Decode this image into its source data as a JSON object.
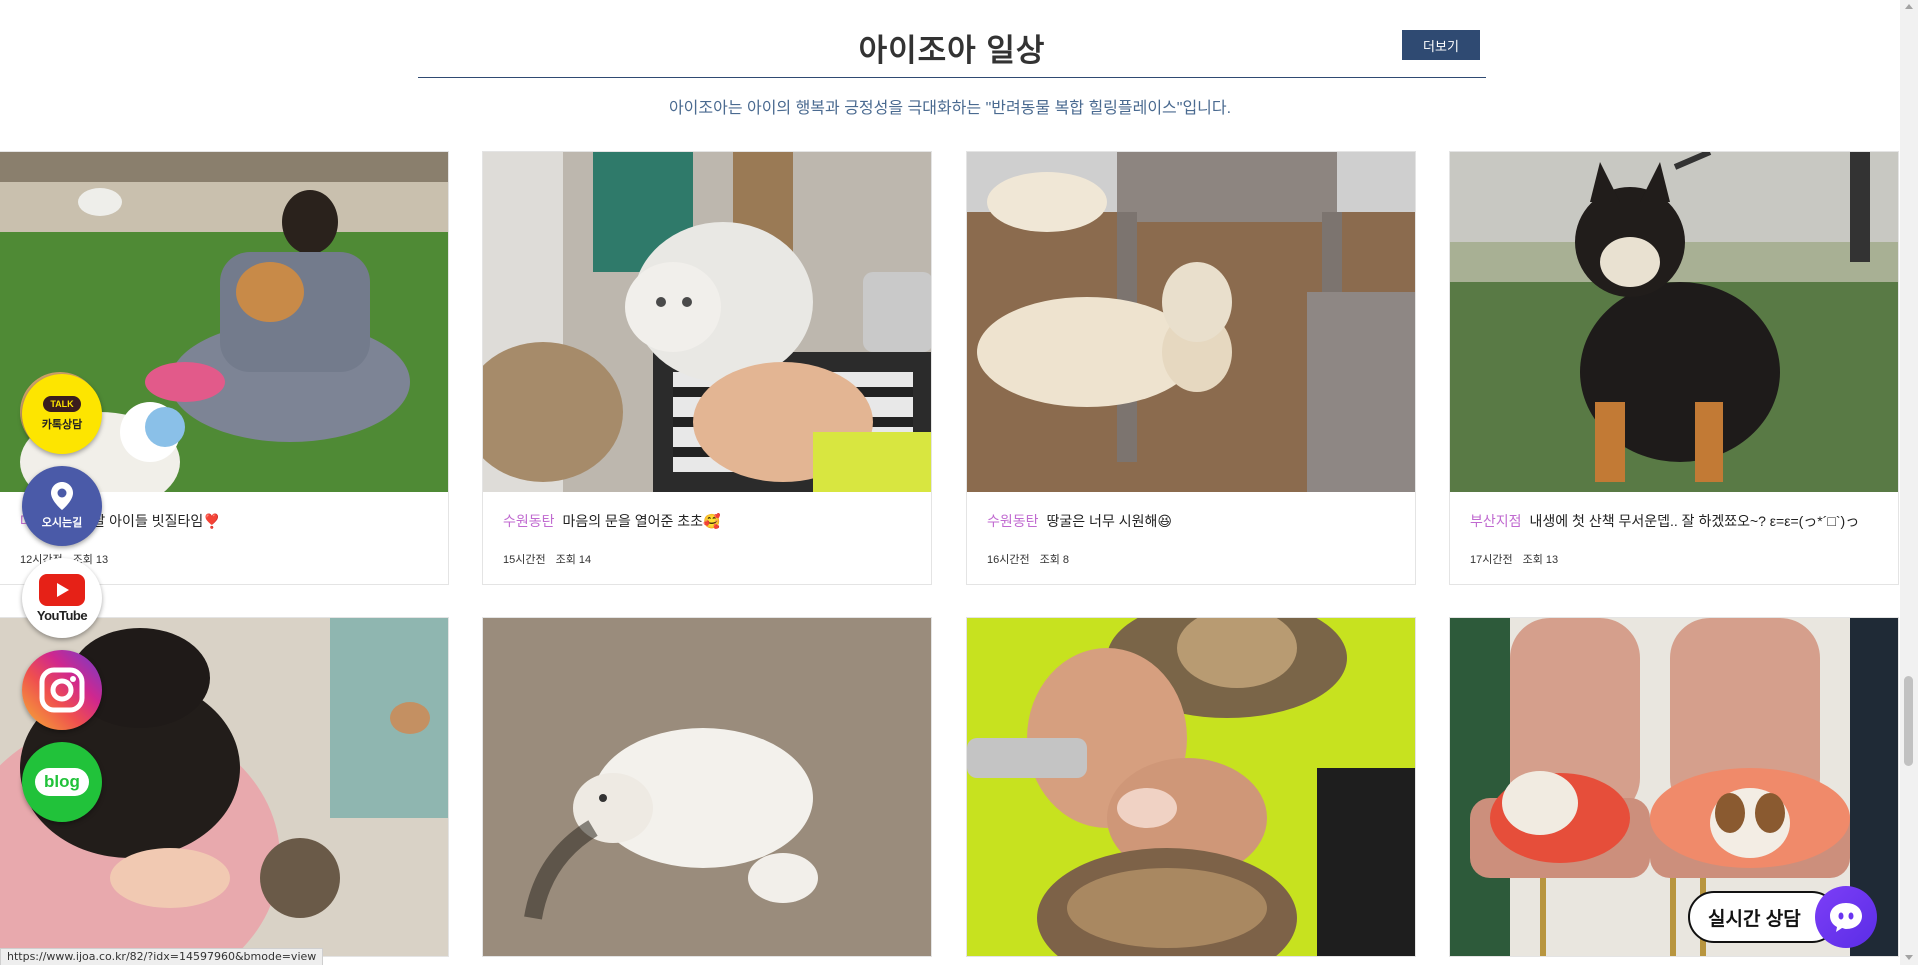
{
  "section": {
    "title": "아이조아 일상",
    "more_label": "더보기",
    "subtitle": "아이조아는 아이의 행복과 긍정성을 극대화하는 \"반려동물 복합 힐링플레이스\"입니다."
  },
  "posts": [
    {
      "branch": "대",
      "text": "날씨좋은날 아이들 빗질타임❣️",
      "time": "12시간전",
      "views": "조회 13"
    },
    {
      "branch": "수원동탄",
      "text": "마음의 문을 열어준 초초🥰",
      "time": "15시간전",
      "views": "조회 14"
    },
    {
      "branch": "수원동탄",
      "text": "땅굴은 너무 시원해😆",
      "time": "16시간전",
      "views": "조회 8"
    },
    {
      "branch": "부산지점",
      "text": "내생에 첫 산책 무서운뎁.. 잘 하겠쬬오~? ε=ε=(っ*´□`)っ",
      "time": "17시간전",
      "views": "조회 13"
    }
  ],
  "floating": {
    "kakao_badge": "TALK",
    "kakao_label": "카톡상담",
    "map_label": "오시는길",
    "youtube_label": "YouTube",
    "blog_label": "blog"
  },
  "chat": {
    "label": "실시간 상담"
  },
  "status_url": "https://www.ijoa.co.kr/82/?idx=14597960&bmode=view",
  "colors": {
    "accent": "#2f4a72",
    "branch": "#c06ad0",
    "chat": "#6a35f0",
    "kakao": "#fde500"
  }
}
